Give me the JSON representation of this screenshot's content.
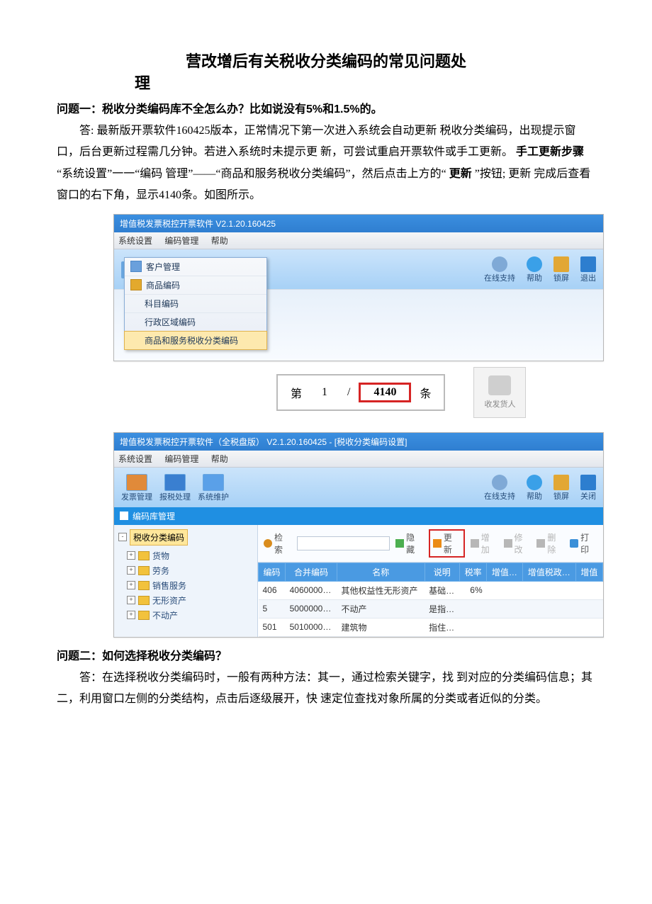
{
  "title_line1": "营改增后有关税收分类编码的常见问题处",
  "title_line2": "理",
  "q1": {
    "heading": "问题一：税收分类编码库不全怎么办？比如说没有5%和1.5%的。",
    "ans_a": "答: 最新版开票软件160425版本，正常情况下第一次进入系统会自动更新 税收分类编码，出现提示窗口，后台更新过程需几分钟。若进入系统时未提示更 新，可尝试重启开票软件或手工更新。",
    "bold_step": "手工更新步骤",
    "ans_b": " “系统设置”一一“编码 管理”——“商品和服务税收分类编码”，然后点击上方的“",
    "bold_update": "更新",
    "ans_c": "”按钮; 更新 完成后查看窗口的右下角，显示4140条。如图所示。"
  },
  "app1": {
    "title": "增值税发票税控开票软件   V2.1.20.160425",
    "menu": [
      "系统设置",
      "编码管理",
      "帮助"
    ],
    "tb_right": [
      {
        "label": "在线支持",
        "cls": "sup"
      },
      {
        "label": "帮助",
        "cls": "help"
      },
      {
        "label": "锁屏",
        "cls": "lock"
      },
      {
        "label": "退出",
        "cls": "exit"
      }
    ],
    "dropdown": [
      "客户管理",
      "商品编码",
      "科目编码",
      "行政区域编码",
      "商品和服务税收分类编码"
    ],
    "pager": {
      "label1": "第",
      "current": "1",
      "sep": "/",
      "total": "4140",
      "label2": "条"
    },
    "receiver": "收发货人"
  },
  "app2": {
    "title": "增值税发票税控开票软件（全税盘版）  V2.1.20.160425  -  [税收分类编码设置]",
    "menu": [
      "系统设置",
      "编码管理",
      "帮助"
    ],
    "tb_left": [
      "发票管理",
      "报税处理",
      "系统维护"
    ],
    "tb_right": [
      {
        "label": "在线支持",
        "cls": "sup"
      },
      {
        "label": "帮助",
        "cls": "help"
      },
      {
        "label": "锁屏",
        "cls": "lock"
      },
      {
        "label": "关闭",
        "cls": "close"
      }
    ],
    "subbar": "编码库管理",
    "tree_root": "税收分类编码",
    "tree_items": [
      "货物",
      "劳务",
      "销售服务",
      "无形资产",
      "不动产"
    ],
    "search": {
      "label": "检索",
      "hide": "隐藏",
      "update": "更新",
      "add": "增加",
      "modify": "修改",
      "delete": "删除",
      "print": "打印"
    },
    "columns": [
      "编码",
      "合并编码",
      "名称",
      "说明",
      "税率",
      "增值…",
      "增值税政…",
      "增值"
    ],
    "rows": [
      {
        "code": "406",
        "merge": "4060000…",
        "name": "其他权益性无形资产",
        "note": "基础…",
        "rate": "6%"
      },
      {
        "code": "5",
        "merge": "5000000…",
        "name": "不动产",
        "note": "是指…",
        "rate": ""
      },
      {
        "code": "501",
        "merge": "5010000…",
        "name": "建筑物",
        "note": "指住…",
        "rate": ""
      }
    ]
  },
  "q2": {
    "heading": "问题二：如何选择税收分类编码？",
    "ans": "答：在选择税收分类编码时，一般有两种方法：其一，通过检索关键字，找 到对应的分类编码信息；其二，利用窗口左侧的分类结构，点击后逐级展开，快 速定位查找对象所属的分类或者近似的分类。"
  }
}
